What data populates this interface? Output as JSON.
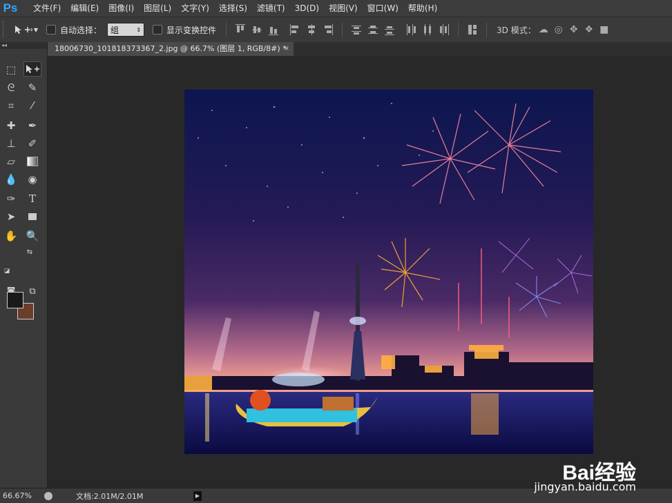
{
  "app": {
    "logo": "Ps"
  },
  "menu": [
    "文件(F)",
    "编辑(E)",
    "图像(I)",
    "图层(L)",
    "文字(Y)",
    "选择(S)",
    "滤镜(T)",
    "3D(D)",
    "视图(V)",
    "窗口(W)",
    "帮助(H)"
  ],
  "options": {
    "auto_select_label": "自动选择：",
    "auto_select_value": "组",
    "transform_label": "显示变换控件",
    "mode3d_label": "3D 模式："
  },
  "document": {
    "tab_title": "18006730_101818373367_2.jpg @ 66.7% (图层 1, RGB/8#) *",
    "close": "×"
  },
  "status": {
    "zoom": "66.67%",
    "docsize": "文档:2.01M/2.01M"
  },
  "watermark": {
    "brand": "Bai经验",
    "url": "jingyan.baidu.com"
  },
  "colors": {
    "foreground": "#1a1a1a",
    "background": "#6b3e2a",
    "accent": "#31a8ff"
  },
  "tools": [
    "marquee-icon",
    "move-icon",
    "lasso-icon",
    "quick-select-icon",
    "crop-icon",
    "eyedropper-icon",
    "healing-icon",
    "brush-icon",
    "stamp-icon",
    "history-brush-icon",
    "eraser-icon",
    "gradient-icon",
    "blur-icon",
    "dodge-icon",
    "pen-icon",
    "type-icon",
    "path-select-icon",
    "shape-icon",
    "hand-icon",
    "zoom-icon"
  ]
}
